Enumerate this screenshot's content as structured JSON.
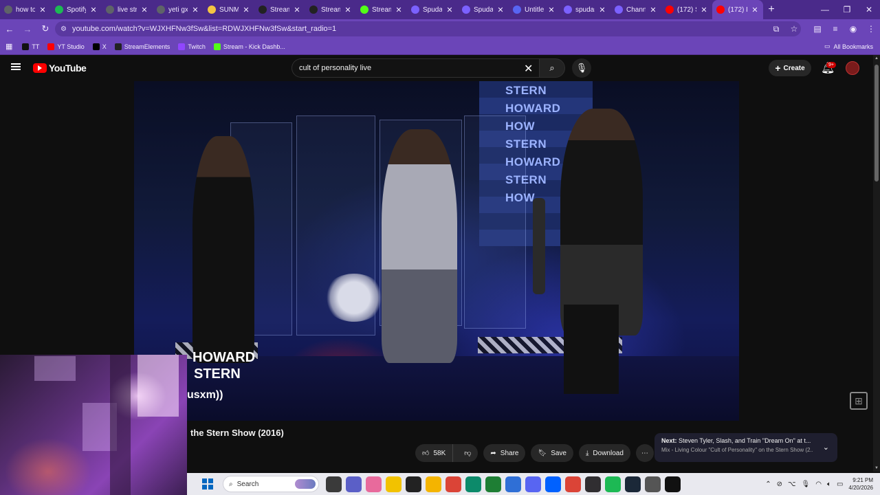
{
  "tabs": [
    {
      "title": "how to",
      "favicon_color": "#5f6368",
      "active": false
    },
    {
      "title": "Spotify",
      "favicon_color": "#1db954",
      "active": false
    },
    {
      "title": "live stre",
      "favicon_color": "#5f6368",
      "active": false
    },
    {
      "title": "yeti gx",
      "favicon_color": "#5f6368",
      "active": false
    },
    {
      "title": "SUNMO",
      "favicon_color": "#f4c542",
      "active": false
    },
    {
      "title": "Stream",
      "favicon_color": "#222222",
      "active": false
    },
    {
      "title": "Stream",
      "favicon_color": "#222222",
      "active": false
    },
    {
      "title": "Stream",
      "favicon_color": "#53fc18",
      "active": false
    },
    {
      "title": "Spudas",
      "favicon_color": "#7b61ff",
      "active": false
    },
    {
      "title": "Spudas",
      "favicon_color": "#7b61ff",
      "active": false
    },
    {
      "title": "Untitled",
      "favicon_color": "#5865f2",
      "active": false
    },
    {
      "title": "spudas",
      "favicon_color": "#7b61ff",
      "active": false
    },
    {
      "title": "Channe",
      "favicon_color": "#7b61ff",
      "active": false
    },
    {
      "title": "(172) S",
      "favicon_color": "#ff0000",
      "active": false
    },
    {
      "title": "(172) Li",
      "favicon_color": "#ff0000",
      "active": true
    }
  ],
  "address": {
    "url": "youtube.com/watch?v=WJXHFNw3fSw&list=RDWJXHFNw3fSw&start_radio=1"
  },
  "bookmarks": [
    {
      "label": "TT",
      "color": "#111111"
    },
    {
      "label": "YT Studio",
      "color": "#ff0000"
    },
    {
      "label": "X",
      "color": "#000000"
    },
    {
      "label": "StreamElements",
      "color": "#222222"
    },
    {
      "label": "Twitch",
      "color": "#9146ff"
    },
    {
      "label": "Stream - Kick Dashb...",
      "color": "#53fc18"
    }
  ],
  "bookmarks_all": "All Bookmarks",
  "youtube": {
    "logo_text": "YouTube",
    "search_value": "cult of personality live",
    "create_label": "Create",
    "notif_badge": "9+"
  },
  "video": {
    "watermark_line1": "HOWARD",
    "watermark_line2": "STERN",
    "watermark_sirius": "usxm))",
    "banner_lines": [
      "STERN",
      "HOWARD",
      "HOW",
      "STERN",
      "HOWARD",
      "STERN",
      "HOW"
    ]
  },
  "below": {
    "title": "the Stern Show (2016)",
    "like_count": "58K",
    "share": "Share",
    "save": "Save",
    "download": "Download"
  },
  "next": {
    "label": "Next:",
    "title": "Steven Tyler, Slash, and Train \"Dream On\" at t...",
    "subtitle": "Mix - Living Colour \"Cult of Personality\" on the Stern Show (2..."
  },
  "taskbar": {
    "search_placeholder": "Search",
    "time": "9:21 PM",
    "date": "4/20/2026",
    "apps": [
      {
        "name": "file-explorer",
        "color": "#3a3a3a"
      },
      {
        "name": "teams",
        "color": "#5b5fc7"
      },
      {
        "name": "copilot",
        "color": "#e86a9c"
      },
      {
        "name": "notification-app",
        "color": "#f2c200"
      },
      {
        "name": "alien-app",
        "color": "#222222"
      },
      {
        "name": "folder",
        "color": "#f4b400"
      },
      {
        "name": "chrome",
        "color": "#db4437"
      },
      {
        "name": "edge",
        "color": "#0c8a6a"
      },
      {
        "name": "spreadsheet",
        "color": "#1e7e34"
      },
      {
        "name": "mail",
        "color": "#2f6fd6"
      },
      {
        "name": "discord",
        "color": "#5865f2"
      },
      {
        "name": "dropbox",
        "color": "#0061ff"
      },
      {
        "name": "chrome-2",
        "color": "#db4437"
      },
      {
        "name": "obs",
        "color": "#302e31"
      },
      {
        "name": "spotify",
        "color": "#1db954"
      },
      {
        "name": "steam",
        "color": "#1b2838"
      },
      {
        "name": "settings",
        "color": "#555555"
      },
      {
        "name": "g-app",
        "color": "#111111"
      }
    ]
  }
}
